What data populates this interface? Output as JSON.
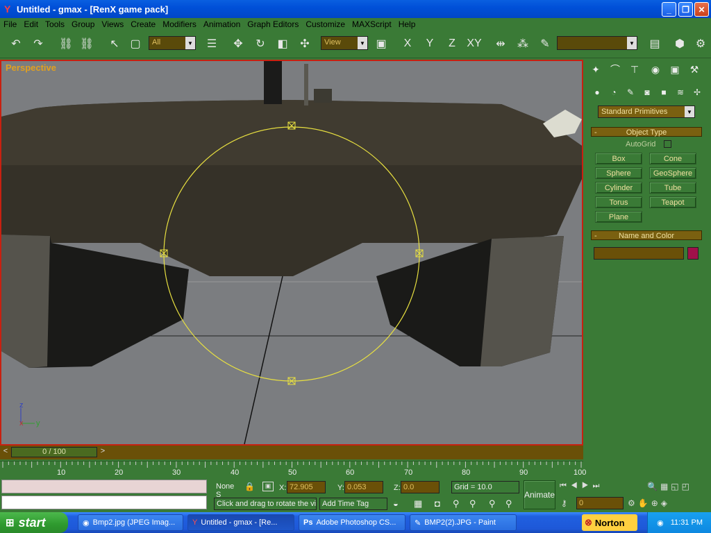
{
  "window": {
    "title": "Untitled - gmax - [RenX game pack]"
  },
  "menu": [
    "File",
    "Edit",
    "Tools",
    "Group",
    "Views",
    "Create",
    "Modifiers",
    "Animation",
    "Graph Editors",
    "Customize",
    "MAXScript",
    "Help"
  ],
  "toolbar": {
    "selection_filter": "All",
    "ref_coord": "View",
    "named_sel": ""
  },
  "viewport": {
    "label": "Perspective",
    "axes": {
      "z": "z",
      "x": "x",
      "y": "y"
    }
  },
  "command_panel": {
    "dropdown": "Standard Primitives",
    "object_type": {
      "header": "Object Type",
      "autogrid": "AutoGrid",
      "buttons": [
        "Box",
        "Cone",
        "Sphere",
        "GeoSphere",
        "Cylinder",
        "Tube",
        "Torus",
        "Teapot",
        "Plane"
      ]
    },
    "name_color": {
      "header": "Name and Color",
      "name_value": "",
      "color": "#a0104a"
    }
  },
  "time": {
    "slider": "0 / 100",
    "ruler": [
      "10",
      "20",
      "30",
      "40",
      "50",
      "60",
      "70",
      "80",
      "90",
      "100"
    ]
  },
  "status": {
    "selection": "None S",
    "x_label": "X:",
    "x_value": "72.905",
    "y_label": "Y:",
    "y_value": "0.053",
    "z_label": "Z:",
    "z_value": "0.0",
    "grid": "Grid = 10.0",
    "prompt": "Click and drag to rotate the vie",
    "add_time_tag": "Add Time Tag",
    "animate": "Animate",
    "frame": "0"
  },
  "taskbar": {
    "start": "start",
    "tasks": [
      "Bmp2.jpg (JPEG Imag...",
      "Untitled - gmax - [Re...",
      "Adobe Photoshop CS...",
      "BMP2(2).JPG - Paint"
    ],
    "norton": "Norton",
    "clock": "11:31 PM"
  },
  "colors": {
    "accent_green": "#3a7a36",
    "selection_yellow": "#e8e040",
    "viewport_border": "#c82010"
  }
}
